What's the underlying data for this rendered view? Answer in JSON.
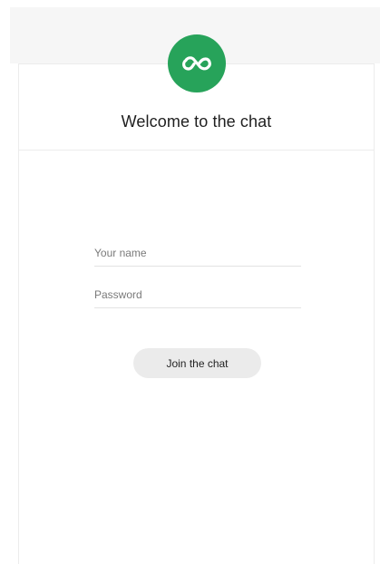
{
  "header": {
    "logo_icon": "infinity-cloud-icon",
    "title": "Welcome to the chat"
  },
  "form": {
    "name_placeholder": "Your name",
    "name_value": "",
    "password_placeholder": "Password",
    "password_value": "",
    "join_label": "Join the chat"
  },
  "colors": {
    "brand": "#27a35a",
    "button_bg": "#ebebeb"
  }
}
